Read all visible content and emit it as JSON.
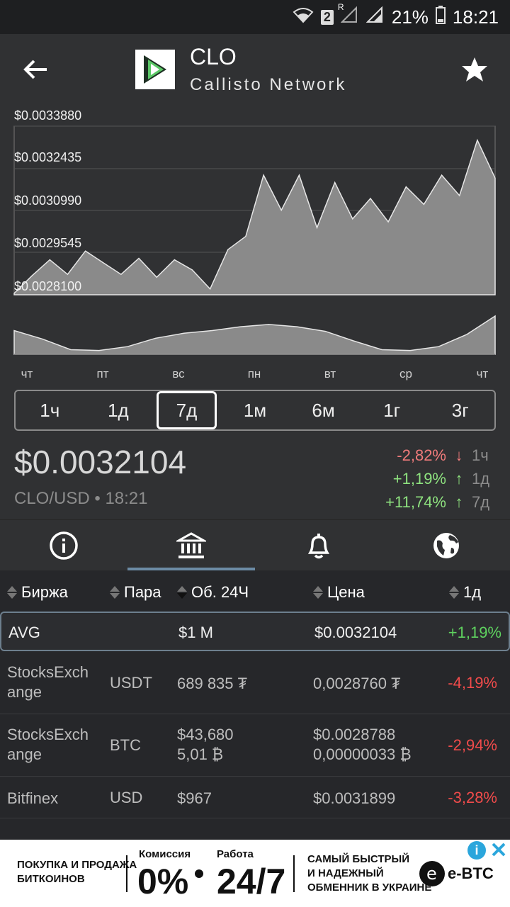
{
  "status": {
    "sim_badge": "2",
    "roaming": "R",
    "battery": "21%",
    "time": "18:21"
  },
  "coin": {
    "symbol": "CLO",
    "name": "Callisto Network"
  },
  "chart": {
    "y_labels": [
      "$0.0033880",
      "$0.0032435",
      "$0.0030990",
      "$0.0029545",
      "$0.0028100"
    ],
    "x_labels": [
      "чт",
      "пт",
      "вс",
      "пн",
      "вт",
      "ср",
      "чт"
    ]
  },
  "chart_data": {
    "type": "area",
    "title": "",
    "xlabel": "",
    "ylabel": "",
    "ylim": [
      0.00281,
      0.003388
    ],
    "x": [
      "чт",
      "пт",
      "вс",
      "пн",
      "вт",
      "ср",
      "чт"
    ],
    "series": [
      {
        "values": [
          0.002815,
          0.002875,
          0.00293,
          0.00288,
          0.00296,
          0.00292,
          0.00288,
          0.002935,
          0.00287,
          0.00293,
          0.002895,
          0.00283,
          0.002965,
          0.00301,
          0.00322,
          0.0031,
          0.00322,
          0.00304,
          0.003195,
          0.00307,
          0.00314,
          0.00306,
          0.00318,
          0.00312,
          0.00322,
          0.00315,
          0.00334,
          0.00321
        ]
      }
    ],
    "volume_values": [
      0.62,
      0.4,
      0.12,
      0.1,
      0.2,
      0.42,
      0.55,
      0.62,
      0.72,
      0.78,
      0.72,
      0.6,
      0.35,
      0.12,
      0.1,
      0.2,
      0.52,
      1.0
    ]
  },
  "ranges": [
    "1ч",
    "1д",
    "7д",
    "1м",
    "6м",
    "1г",
    "3г"
  ],
  "active_range": "7д",
  "price": {
    "value": "$0.0032104",
    "pair": "CLO/USD",
    "time": "18:21"
  },
  "changes": [
    {
      "pct": "-2,82%",
      "arrow": "↓",
      "period": "1ч",
      "dir": "neg"
    },
    {
      "pct": "+1,19%",
      "arrow": "↑",
      "period": "1д",
      "dir": "pos"
    },
    {
      "pct": "+11,74%",
      "arrow": "↑",
      "period": "7д",
      "dir": "pos"
    }
  ],
  "table": {
    "headers": {
      "exchange": "Биржа",
      "pair": "Пара",
      "vol": "Об. 24Ч",
      "price": "Цена",
      "change": "1д"
    },
    "avg": {
      "name": "AVG",
      "vol": "$1 M",
      "price": "$0.0032104",
      "change": "+1,19%"
    },
    "rows": [
      {
        "exchange": [
          "StocksExch",
          "ange"
        ],
        "pair": "USDT",
        "vol": [
          "689 835 ₮"
        ],
        "price": [
          "0,0028760 ₮"
        ],
        "change": "-4,19%"
      },
      {
        "exchange": [
          "StocksExch",
          "ange"
        ],
        "pair": "BTC",
        "vol": [
          "$43,680",
          "5,01 ₿"
        ],
        "price": [
          "$0.0028788",
          "0,00000033 ₿"
        ],
        "change": "-2,94%"
      },
      {
        "exchange": [
          "Bitfinex"
        ],
        "pair": "USD",
        "vol": [
          "$967"
        ],
        "price": [
          "$0.0031899"
        ],
        "change": "-3,28%"
      }
    ]
  },
  "ad": {
    "line1": "ПОКУПКА И ПРОДАЖА",
    "line2": "БИТКОИНОВ",
    "fee_label": "Комиссия",
    "fee_value": "0%",
    "work_label": "Работа",
    "work_value": "24/7",
    "slogan1": "САМЫЙ БЫСТРЫЙ",
    "slogan2": "И НАДЕЖНЫЙ",
    "slogan3": "ОБМЕННИК В УКРАИНЕ",
    "brand": "e-BTC"
  }
}
